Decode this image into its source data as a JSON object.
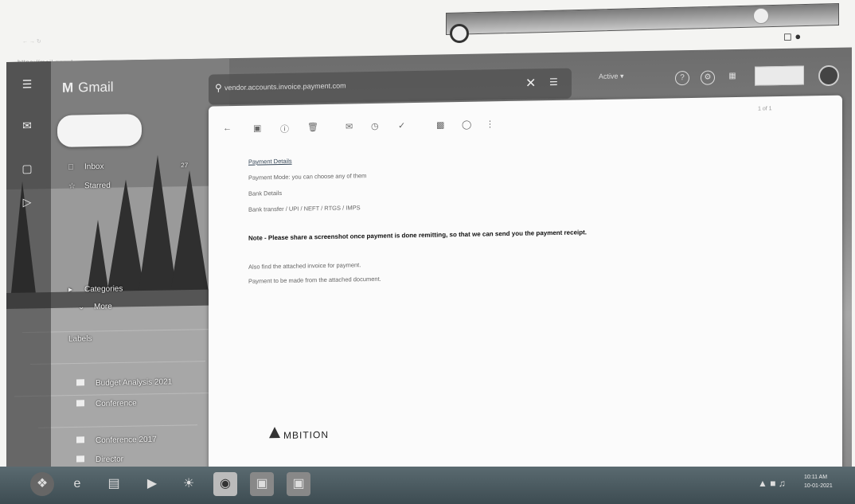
{
  "browser": {
    "url": "https://mail.google.com",
    "faint_text": "←  →  ↻"
  },
  "gmail": {
    "logo_mark": "M",
    "logo_text": "Gmail",
    "compose_label": "",
    "search_query": "vendor.accounts.invoice.payment.com"
  },
  "nav": {
    "inbox": {
      "label": "Inbox",
      "count": "27"
    },
    "starred": "Starred",
    "categories": "Categories",
    "more": "More",
    "labels": "Labels"
  },
  "folders": [
    {
      "label": "Budget Analysis 2021"
    },
    {
      "label": "Conference"
    },
    {
      "label": "Conference 2017"
    },
    {
      "label": "Director"
    }
  ],
  "topbar": {
    "status_label": "Active",
    "ext_label": "",
    "page_info": "1 of 1"
  },
  "message": {
    "line1": "Payment Details",
    "line2": "Payment Mode: you can choose any of them",
    "line3": "Bank Details",
    "line4": "Bank transfer / UPI / NEFT / RTGS / IMPS",
    "note": "Note - Please share a screenshot once payment is done remitting, so that we can send you the payment receipt.",
    "line5": "Also find the attached invoice for payment.",
    "line6": "Payment to be made from the attached document."
  },
  "signature": {
    "company": "MBITION"
  },
  "taskbar": {
    "time": "10:11 AM",
    "date": "10-01-2021"
  },
  "colors": {
    "accent": "#d5d5d5",
    "pane": "#fbfbfb",
    "taskbar": "#4d5b61"
  },
  "icons": [
    "menu-icon",
    "gmail-icon",
    "search-icon",
    "close-icon",
    "filter-icon",
    "help-icon",
    "settings-icon",
    "apps-icon",
    "avatar",
    "archive-icon",
    "delete-icon",
    "mark-unread-icon",
    "snooze-icon",
    "more-icon",
    "back-icon",
    "inbox-icon",
    "star-icon",
    "folder-icon"
  ]
}
